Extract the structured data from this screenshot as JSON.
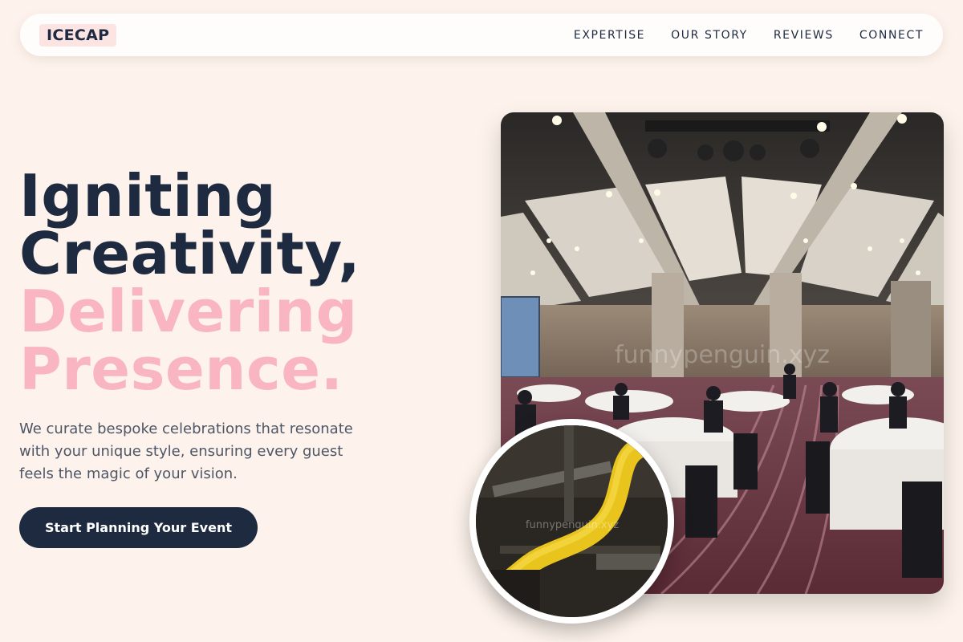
{
  "nav": {
    "logo": "ICECAP",
    "links": [
      {
        "label": "EXPERTISE"
      },
      {
        "label": "OUR STORY"
      },
      {
        "label": "REVIEWS"
      },
      {
        "label": "CONNECT"
      }
    ]
  },
  "hero": {
    "title_lines": [
      {
        "text": "Igniting",
        "color": "#1e2a40"
      },
      {
        "text": "Creativity,",
        "color": "#1e2a40"
      },
      {
        "text": "Delivering",
        "color": "#f9b5c2"
      },
      {
        "text": "Presence.",
        "color": "#f9b5c2"
      }
    ],
    "description": "We curate bespoke celebrations that resonate with your unique style, ensuring every guest feels the magic of your vision.",
    "cta_label": "Start Planning Your Event"
  },
  "images": {
    "main_photo": {
      "watermark": "funnypenguin.xyz"
    },
    "circle_photo": {
      "watermark": "funnypenguin.xyz"
    }
  },
  "colors": {
    "background": "#fdf3ec",
    "navy": "#1e2a40",
    "pink": "#f9b5c2",
    "text_muted": "#4d5666"
  }
}
